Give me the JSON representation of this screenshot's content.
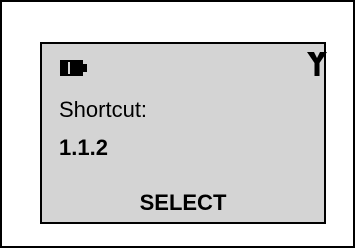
{
  "display": {
    "battery_icon": "battery-icon",
    "signal_icon": "antenna-signal-icon",
    "label": "Shortcut:",
    "value": "1.1.2",
    "softkey_label": "SELECT"
  },
  "colors": {
    "screen_background": "#d4d4d4",
    "text": "#000000"
  }
}
